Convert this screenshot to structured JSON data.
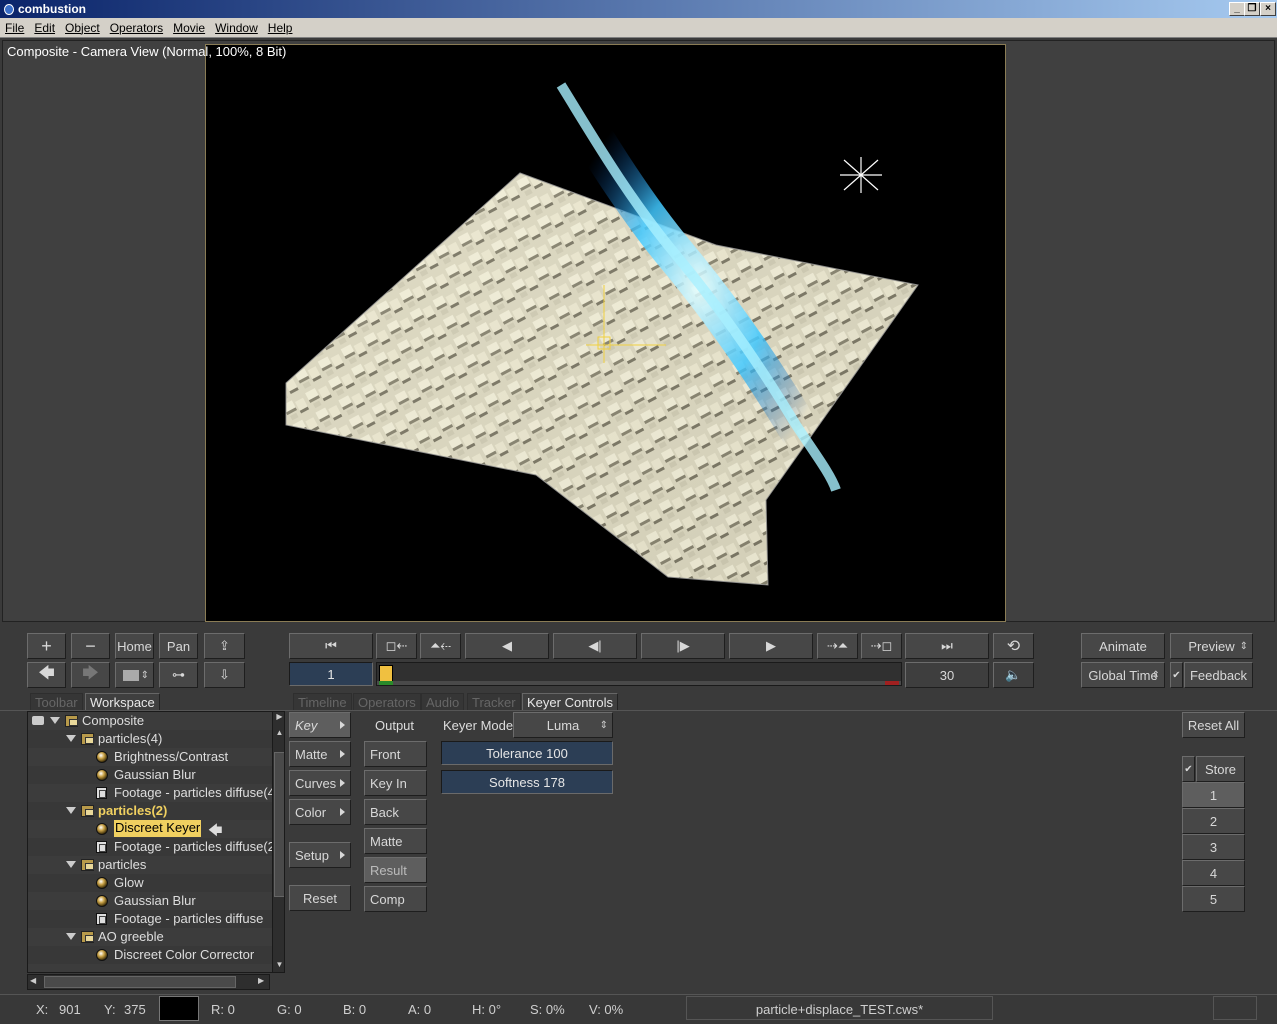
{
  "app": {
    "title": "combustion"
  },
  "menu": [
    "File",
    "Edit",
    "Object",
    "Operators",
    "Movie",
    "Window",
    "Help"
  ],
  "viewer": {
    "title": "Composite - Camera View (Normal, 100%, 8 Bit)"
  },
  "nav": {
    "plus": "+",
    "minus": "−",
    "home": "Home",
    "pan": "Pan"
  },
  "transport": {
    "current_frame": "1",
    "end_frame": "30"
  },
  "right_controls": {
    "animate": "Animate",
    "preview": "Preview",
    "global_time": "Global Time",
    "feedback": "Feedback"
  },
  "tabs": {
    "toolbar": "Toolbar",
    "workspace": "Workspace",
    "timeline": "Timeline",
    "operators": "Operators",
    "audio": "Audio",
    "tracker": "Tracker",
    "keyer_controls": "Keyer Controls"
  },
  "tree": [
    {
      "label": "Composite",
      "icon": "composite-icon",
      "indent": 0
    },
    {
      "label": "particles(4)",
      "icon": "group-icon",
      "indent": 1
    },
    {
      "label": "Brightness/Contrast",
      "icon": "operator-icon",
      "indent": 2
    },
    {
      "label": "Gaussian Blur",
      "icon": "operator-icon",
      "indent": 2
    },
    {
      "label": "Footage - particles diffuse(4",
      "icon": "footage-icon",
      "indent": 2
    },
    {
      "label": "particles(2)",
      "icon": "group-icon",
      "indent": 1
    },
    {
      "label": "Discreet Keyer",
      "icon": "operator-icon",
      "indent": 2
    },
    {
      "label": "Footage - particles diffuse(2",
      "icon": "footage-icon",
      "indent": 2
    },
    {
      "label": "particles",
      "icon": "group-icon",
      "indent": 1
    },
    {
      "label": "Glow",
      "icon": "operator-icon",
      "indent": 2
    },
    {
      "label": "Gaussian Blur",
      "icon": "operator-icon",
      "indent": 2
    },
    {
      "label": "Footage - particles diffuse",
      "icon": "footage-icon",
      "indent": 2
    },
    {
      "label": "AO greeble",
      "icon": "group-icon",
      "indent": 1
    },
    {
      "label": "Discreet Color Corrector",
      "icon": "operator-icon",
      "indent": 2
    }
  ],
  "keyer": {
    "col1": [
      "Key",
      "Matte",
      "Curves",
      "Color",
      "Setup",
      "Reset"
    ],
    "output_label": "Output",
    "col2": [
      "Front",
      "Key In",
      "Back",
      "Matte",
      "Result",
      "Comp"
    ],
    "mode_label": "Keyer Mode",
    "mode_value": "Luma",
    "tolerance": "Tolerance 100",
    "softness": "Softness 178",
    "reset_all": "Reset All",
    "store": "Store",
    "slots": [
      "1",
      "2",
      "3",
      "4",
      "5"
    ]
  },
  "status": {
    "x_label": "X:",
    "x": "901",
    "y_label": "Y:",
    "y": "375",
    "r": "R: 0",
    "g": "G: 0",
    "b": "B: 0",
    "a": "A: 0",
    "h": "H: 0°",
    "s": "S: 0%",
    "v": "V: 0%",
    "file": "particle+displace_TEST.cws*"
  },
  "colors": {
    "viewer_bg": "#404040",
    "panel_bg": "#3a3a3a",
    "highlight": "#f0d060",
    "field": "#2c3e55"
  }
}
